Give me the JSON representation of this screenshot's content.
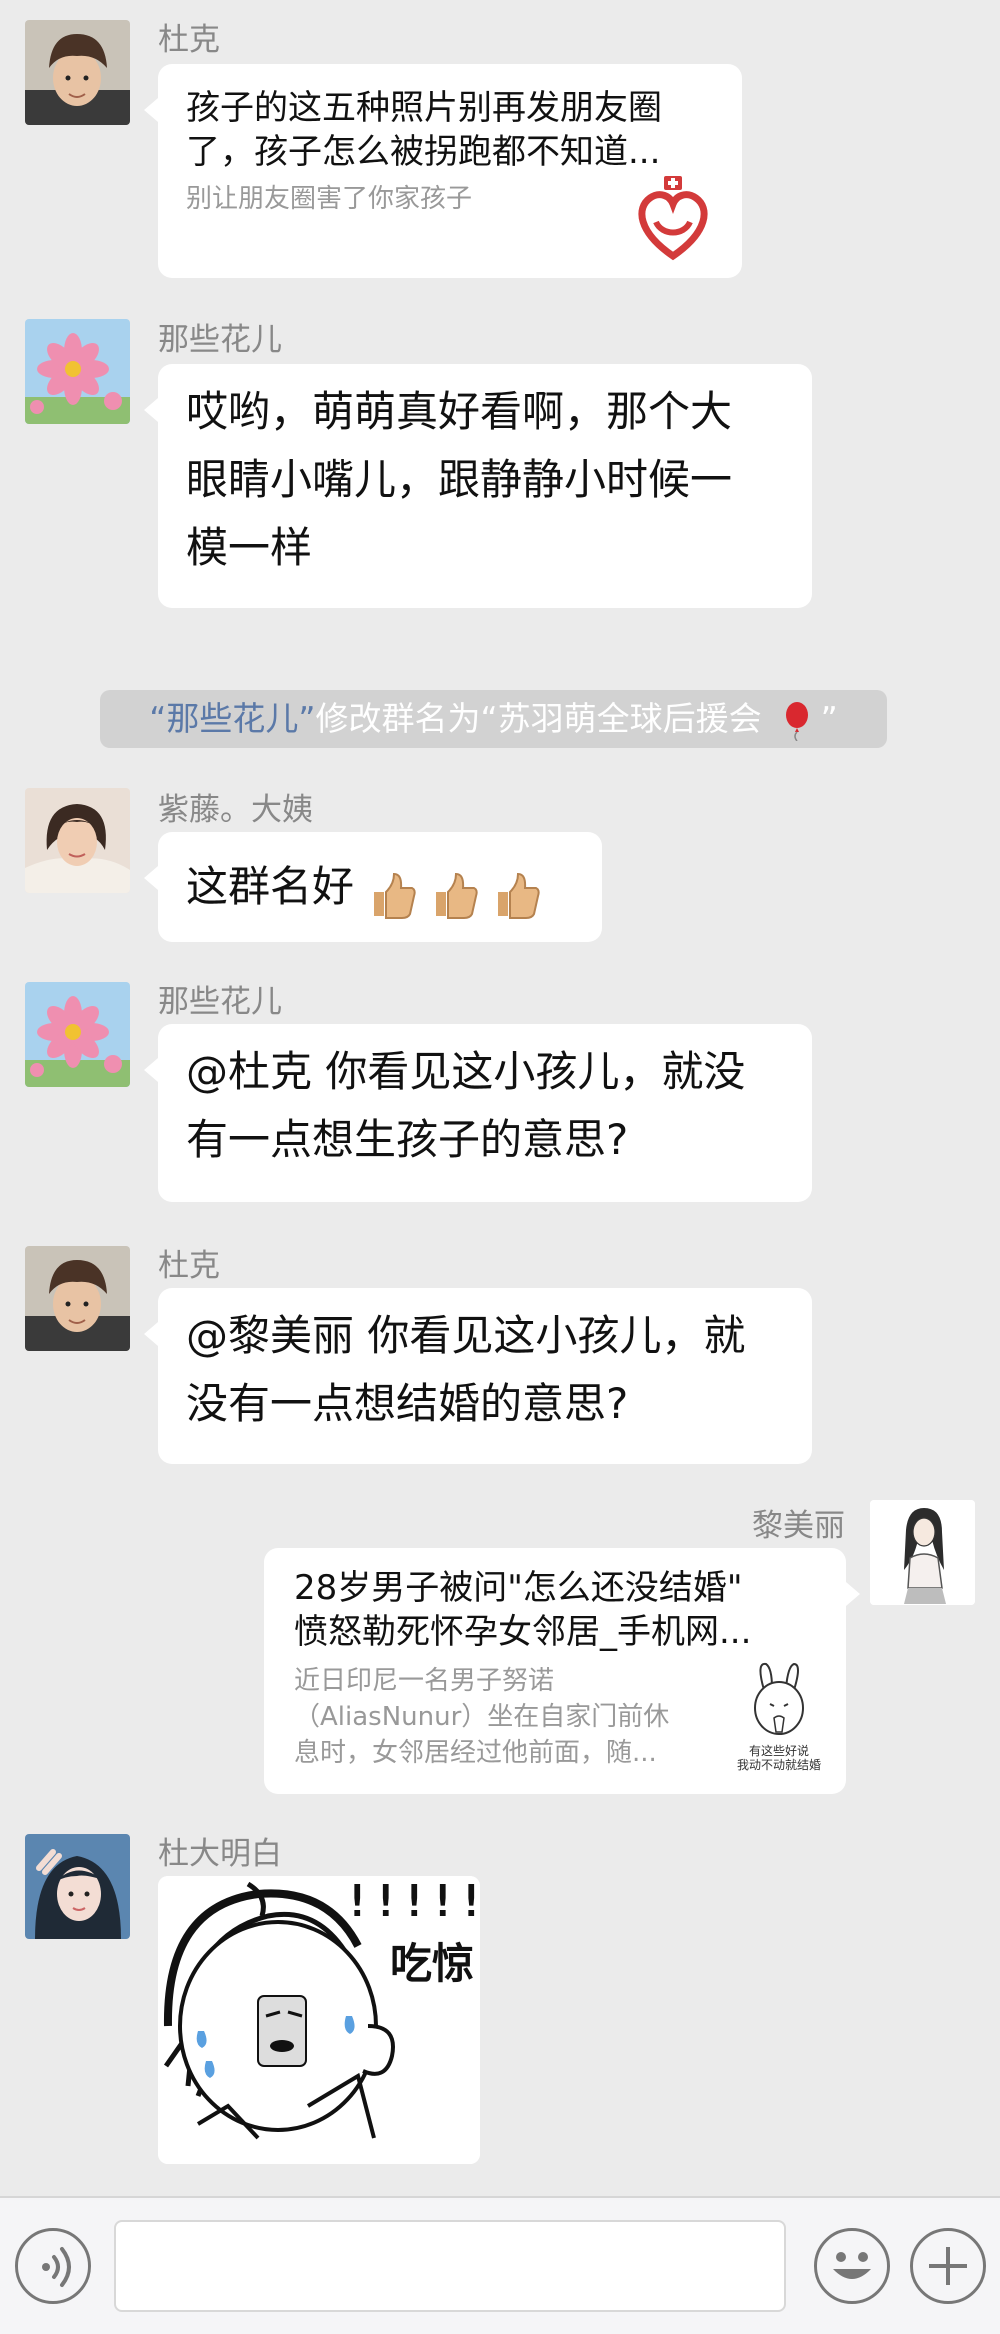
{
  "messages": [
    {
      "sender": "杜克",
      "type": "link",
      "title_line1": "孩子的这五种照片别再发朋友圈",
      "title_line2": "了，孩子怎么被拐跑都不知道...",
      "desc": "别让朋友圈害了你家孩子",
      "thumb_icon": "red-heart-cross-icon"
    },
    {
      "sender": "那些花儿",
      "type": "text",
      "lines": [
        "哎哟，萌萌真好看啊，那个大",
        "眼睛小嘴儿，跟静静小时候一",
        "模一样"
      ]
    },
    {
      "sender": "紫藤。大姨",
      "type": "text",
      "text": "这群名好",
      "emoji": "thumbs-up-icon"
    },
    {
      "sender": "那些花儿",
      "type": "text",
      "lines": [
        "@杜克 你看见这小孩儿，就没",
        "有一点想生孩子的意思?"
      ]
    },
    {
      "sender": "杜克",
      "type": "text",
      "lines": [
        "@黎美丽 你看见这小孩儿，就",
        "没有一点想结婚的意思?"
      ]
    },
    {
      "sender": "黎美丽",
      "type": "link",
      "side": "right",
      "title_line1": "28岁男子被问\"怎么还没结婚\"",
      "title_line2": "愤怒勒死怀孕女邻居_手机网...",
      "desc_line1": "近日印尼一名男子努诺",
      "desc_line2": "（AliasNunur）坐在自家门前休",
      "desc_line3": "息时，女邻居经过他前面，随...",
      "thumb_caption1": "有这些好说",
      "thumb_caption2": "我动不动就结婚"
    },
    {
      "sender": "杜大明白",
      "type": "sticker",
      "sticker_text": "吃惊",
      "sticker_marks": "!!!!!!!"
    }
  ],
  "system_notice": {
    "name": "“那些花儿”",
    "action": "修改群名为“苏羽萌全球后援会",
    "tail": " ”",
    "icon": "balloon-icon"
  },
  "input_bar": {
    "voice_icon": "voice-icon",
    "emoji_icon": "smiley-icon",
    "add_icon": "plus-icon",
    "placeholder": ""
  },
  "colors": {
    "background": "#ebebeb",
    "bubble": "#ffffff",
    "name_text": "#888888",
    "notice_bg": "#d2d2d2",
    "notice_link": "#5b79a8",
    "accent_red": "#d33a3a"
  }
}
